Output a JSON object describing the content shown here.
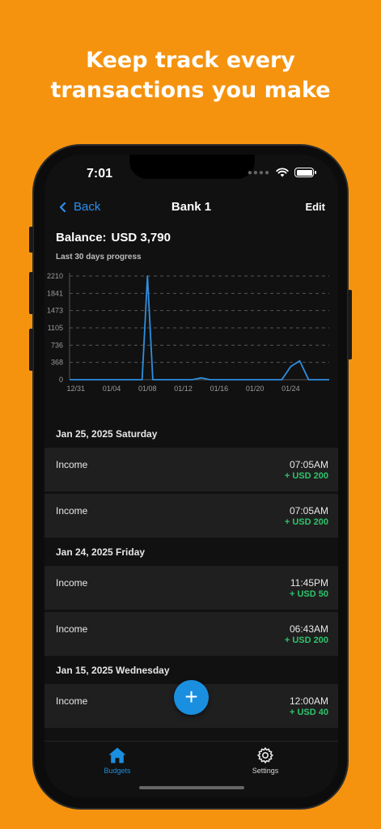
{
  "headline": {
    "line1": "Keep track every",
    "line2": "transactions you make"
  },
  "status_bar": {
    "time": "7:01",
    "signal_icon": "signal-dots-icon",
    "wifi_icon": "wifi-icon",
    "battery_icon": "battery-icon"
  },
  "nav": {
    "back_label": "Back",
    "title": "Bank 1",
    "edit_label": "Edit"
  },
  "balance": {
    "label": "Balance:",
    "value": "USD 3,790"
  },
  "progress_label": "Last 30 days progress",
  "chart_data": {
    "type": "line",
    "title": "",
    "xlabel": "",
    "ylabel": "",
    "ylim": [
      0,
      2210
    ],
    "y_ticks": [
      "0",
      "368",
      "736",
      "1105",
      "1473",
      "1841",
      "2210"
    ],
    "x_tick_labels": [
      "12/31",
      "01/04",
      "01/08",
      "01/12",
      "01/16",
      "01/20",
      "01/24"
    ],
    "x_tick_days": [
      0,
      4,
      8,
      12,
      16,
      20,
      24
    ],
    "grid": true,
    "series": [
      {
        "color": "#2f8fe0",
        "x_days": [
          -0.7,
          0,
          1,
          2,
          3,
          4,
          5,
          6,
          7,
          7.4,
          8,
          8.6,
          9,
          10,
          11,
          12,
          13,
          14,
          15,
          16,
          17,
          18,
          19,
          20,
          21,
          22,
          23,
          24,
          25,
          26,
          27,
          28,
          28.3
        ],
        "y": [
          0,
          0,
          0,
          0,
          0,
          0,
          0,
          0,
          0,
          0,
          2210,
          0,
          0,
          0,
          0,
          0,
          0,
          40,
          0,
          0,
          0,
          0,
          0,
          0,
          0,
          0,
          0,
          280,
          400,
          0,
          0,
          0,
          0
        ]
      }
    ]
  },
  "groups": [
    {
      "date": "Jan 25, 2025 Saturday",
      "items": [
        {
          "name": "Income",
          "time": "07:05AM",
          "amount": "+ USD 200"
        },
        {
          "name": "Income",
          "time": "07:05AM",
          "amount": "+ USD 200"
        }
      ]
    },
    {
      "date": "Jan 24, 2025 Friday",
      "items": [
        {
          "name": "Income",
          "time": "11:45PM",
          "amount": "+ USD 50"
        },
        {
          "name": "Income",
          "time": "06:43AM",
          "amount": "+ USD 200"
        }
      ]
    },
    {
      "date": "Jan 15, 2025 Wednesday",
      "items": [
        {
          "name": "Income",
          "time": "12:00AM",
          "amount": "+ USD 40"
        }
      ]
    }
  ],
  "fab": {
    "label": "+",
    "icon": "plus-icon"
  },
  "tabbar": {
    "tabs": [
      {
        "label": "Budgets",
        "icon": "home-icon",
        "active": true
      },
      {
        "label": "Settings",
        "icon": "gear-icon",
        "active": false
      }
    ],
    "active_color": "#1a8fe0"
  }
}
